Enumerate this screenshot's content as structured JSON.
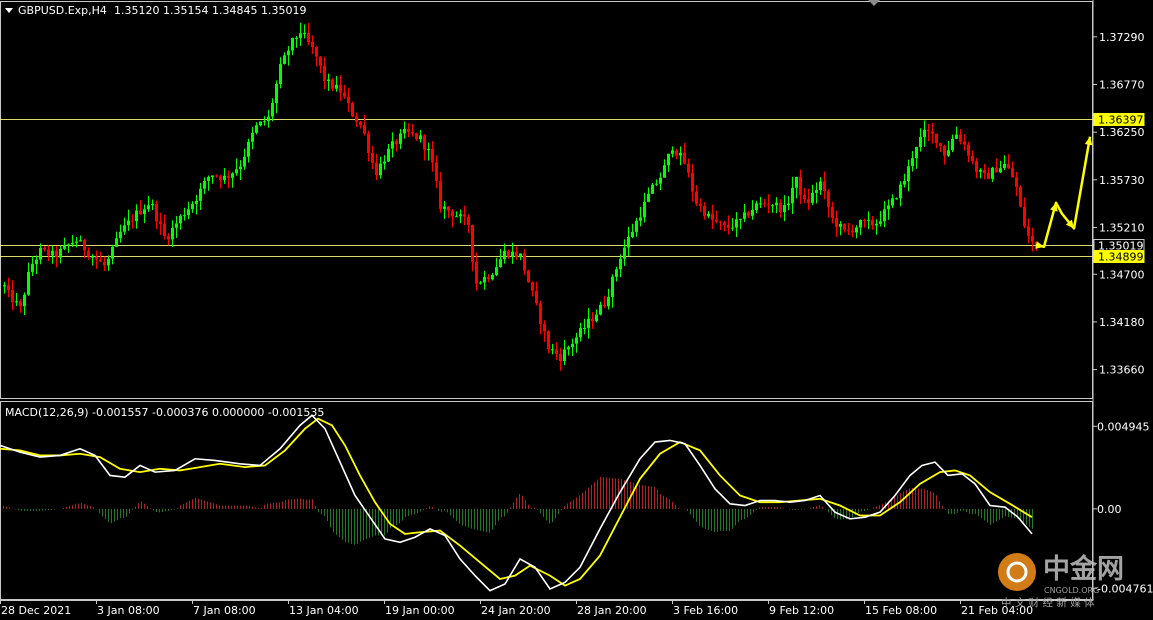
{
  "symbol_header": {
    "symbol": "GBPUSD.Exp,H4",
    "ohlc": "1.35120 1.35154 1.34845 1.35019"
  },
  "macd_header": {
    "label": "MACD(12,26,9) -0.001557 -0.000376 0.000000 -0.001535"
  },
  "colors": {
    "background": "#000000",
    "frame": "#c8c8c8",
    "bull_candle": "#00ff00",
    "bear_candle": "#ff0000",
    "level_line": "#ffff80",
    "yellow": "#ffff00",
    "macd_hist_up": "#b22222",
    "macd_hist_down": "#1f7a1f",
    "macd_line": "#ffffff",
    "signal_line": "#ffff00"
  },
  "watermark": {
    "name": "中金网",
    "sub": "CNGOLD.ORG",
    "tagline": "中 文 财 经 新 媒 体"
  },
  "chart_data": [
    {
      "type": "candlestick",
      "timeframe": "H4",
      "x_ticks": [
        "28 Dec 2021",
        "3 Jan 08:00",
        "7 Jan 08:00",
        "13 Jan 04:00",
        "19 Jan 00:00",
        "24 Jan 20:00",
        "28 Jan 20:00",
        "3 Feb 16:00",
        "9 Feb 12:00",
        "15 Feb 08:00",
        "21 Feb 04:00"
      ],
      "y_ticks": [
        1.3729,
        1.3677,
        1.3625,
        1.3573,
        1.3521,
        1.347,
        1.3418,
        1.3366
      ],
      "y_tick_labels": [
        "1.37290",
        "1.36770",
        "1.36250",
        "1.35730",
        "1.35210",
        "1.34700",
        "1.34180",
        "1.33660"
      ],
      "ylim": [
        1.3335,
        1.3767
      ],
      "levels": [
        {
          "value": 1.36397,
          "label": "1.36397",
          "tag_bg": "#ffff00",
          "tag_fg": "#000000"
        },
        {
          "value": 1.35019,
          "label": "1.35019",
          "tag_bg": "#000000",
          "tag_fg": "#ffffff"
        },
        {
          "value": 1.34899,
          "label": "1.34899",
          "tag_bg": "#ffff00",
          "tag_fg": "#000000"
        }
      ],
      "close_path": [
        [
          0,
          1.3465
        ],
        [
          8,
          1.3448
        ],
        [
          20,
          1.3432
        ],
        [
          30,
          1.3478
        ],
        [
          40,
          1.3495
        ],
        [
          55,
          1.349
        ],
        [
          75,
          1.3508
        ],
        [
          90,
          1.3492
        ],
        [
          105,
          1.3478
        ],
        [
          120,
          1.3515
        ],
        [
          135,
          1.3535
        ],
        [
          150,
          1.3549
        ],
        [
          165,
          1.3508
        ],
        [
          180,
          1.3532
        ],
        [
          195,
          1.3552
        ],
        [
          210,
          1.358
        ],
        [
          225,
          1.3575
        ],
        [
          240,
          1.359
        ],
        [
          255,
          1.363
        ],
        [
          268,
          1.364
        ],
        [
          280,
          1.3695
        ],
        [
          290,
          1.372
        ],
        [
          300,
          1.3735
        ],
        [
          315,
          1.371
        ],
        [
          325,
          1.368
        ],
        [
          340,
          1.367
        ],
        [
          352,
          1.3645
        ],
        [
          362,
          1.363
        ],
        [
          375,
          1.358
        ],
        [
          390,
          1.3608
        ],
        [
          405,
          1.3625
        ],
        [
          420,
          1.3618
        ],
        [
          430,
          1.36
        ],
        [
          440,
          1.3545
        ],
        [
          455,
          1.3535
        ],
        [
          468,
          1.3525
        ],
        [
          475,
          1.346
        ],
        [
          490,
          1.347
        ],
        [
          505,
          1.3495
        ],
        [
          520,
          1.349
        ],
        [
          530,
          1.3455
        ],
        [
          540,
          1.342
        ],
        [
          548,
          1.339
        ],
        [
          560,
          1.338
        ],
        [
          575,
          1.34
        ],
        [
          590,
          1.342
        ],
        [
          605,
          1.344
        ],
        [
          620,
          1.349
        ],
        [
          635,
          1.3525
        ],
        [
          650,
          1.356
        ],
        [
          662,
          1.358
        ],
        [
          672,
          1.361
        ],
        [
          685,
          1.359
        ],
        [
          695,
          1.355
        ],
        [
          710,
          1.353
        ],
        [
          725,
          1.352
        ],
        [
          740,
          1.3528
        ],
        [
          755,
          1.3545
        ],
        [
          770,
          1.3548
        ],
        [
          785,
          1.354
        ],
        [
          795,
          1.3575
        ],
        [
          805,
          1.3545
        ],
        [
          820,
          1.357
        ],
        [
          832,
          1.353
        ],
        [
          845,
          1.3515
        ],
        [
          860,
          1.3525
        ],
        [
          875,
          1.3525
        ],
        [
          890,
          1.3545
        ],
        [
          905,
          1.3575
        ],
        [
          915,
          1.361
        ],
        [
          925,
          1.3625
        ],
        [
          935,
          1.362
        ],
        [
          945,
          1.36
        ],
        [
          955,
          1.3625
        ],
        [
          965,
          1.361
        ],
        [
          975,
          1.3585
        ],
        [
          985,
          1.3575
        ],
        [
          995,
          1.3585
        ],
        [
          1005,
          1.359
        ],
        [
          1015,
          1.357
        ],
        [
          1022,
          1.353
        ],
        [
          1030,
          1.3505
        ],
        [
          1036,
          1.35019
        ]
      ],
      "forecast_path": [
        [
          1036,
          1.35019
        ],
        [
          1044,
          1.35
        ],
        [
          1056,
          1.3548
        ],
        [
          1062,
          1.3536
        ],
        [
          1074,
          1.352
        ],
        [
          1090,
          1.362
        ]
      ]
    },
    {
      "type": "macd",
      "params": "12,26,9",
      "y_tick_labels": [
        "0.004945",
        "0.00",
        "-0.004761"
      ],
      "y_ticks": [
        0.004945,
        0.0,
        -0.004761
      ],
      "ylim": [
        -0.0054,
        0.0064
      ],
      "macd_path": [
        [
          0,
          0.0038
        ],
        [
          20,
          0.0034
        ],
        [
          40,
          0.0031
        ],
        [
          60,
          0.0032
        ],
        [
          80,
          0.0036
        ],
        [
          95,
          0.0032
        ],
        [
          110,
          0.002
        ],
        [
          125,
          0.0019
        ],
        [
          140,
          0.0026
        ],
        [
          155,
          0.0022
        ],
        [
          175,
          0.0023
        ],
        [
          195,
          0.003
        ],
        [
          215,
          0.0029
        ],
        [
          240,
          0.0027
        ],
        [
          260,
          0.0026
        ],
        [
          280,
          0.0036
        ],
        [
          300,
          0.005
        ],
        [
          312,
          0.0056
        ],
        [
          325,
          0.0048
        ],
        [
          340,
          0.0028
        ],
        [
          355,
          0.0008
        ],
        [
          370,
          -0.0005
        ],
        [
          385,
          -0.0018
        ],
        [
          400,
          -0.002
        ],
        [
          415,
          -0.0017
        ],
        [
          430,
          -0.0012
        ],
        [
          445,
          -0.0016
        ],
        [
          460,
          -0.003
        ],
        [
          475,
          -0.004
        ],
        [
          490,
          -0.0049
        ],
        [
          505,
          -0.0045
        ],
        [
          520,
          -0.003
        ],
        [
          535,
          -0.0035
        ],
        [
          550,
          -0.0048
        ],
        [
          565,
          -0.0044
        ],
        [
          580,
          -0.0035
        ],
        [
          600,
          -0.0012
        ],
        [
          620,
          0.001
        ],
        [
          640,
          0.003
        ],
        [
          655,
          0.004
        ],
        [
          670,
          0.0041
        ],
        [
          685,
          0.0039
        ],
        [
          700,
          0.0026
        ],
        [
          715,
          0.0012
        ],
        [
          730,
          0.0003
        ],
        [
          745,
          0.0002
        ],
        [
          760,
          0.0005
        ],
        [
          775,
          0.0005
        ],
        [
          790,
          0.0004
        ],
        [
          805,
          0.0005
        ],
        [
          820,
          0.0008
        ],
        [
          835,
          -0.0002
        ],
        [
          850,
          -0.0006
        ],
        [
          865,
          -0.0005
        ],
        [
          880,
          -0.0002
        ],
        [
          895,
          0.0008
        ],
        [
          910,
          0.002
        ],
        [
          922,
          0.0026
        ],
        [
          935,
          0.0028
        ],
        [
          948,
          0.002
        ],
        [
          962,
          0.0021
        ],
        [
          975,
          0.0015
        ],
        [
          990,
          0.0002
        ],
        [
          1005,
          0.0001
        ],
        [
          1018,
          -0.0005
        ],
        [
          1032,
          -0.0015
        ]
      ],
      "signal_path": [
        [
          0,
          0.0036
        ],
        [
          20,
          0.0035
        ],
        [
          40,
          0.0032
        ],
        [
          60,
          0.0032
        ],
        [
          80,
          0.0033
        ],
        [
          100,
          0.0031
        ],
        [
          120,
          0.0024
        ],
        [
          140,
          0.0022
        ],
        [
          160,
          0.0024
        ],
        [
          180,
          0.0023
        ],
        [
          200,
          0.0025
        ],
        [
          220,
          0.0027
        ],
        [
          245,
          0.0025
        ],
        [
          265,
          0.0026
        ],
        [
          285,
          0.0035
        ],
        [
          305,
          0.0048
        ],
        [
          318,
          0.0054
        ],
        [
          332,
          0.005
        ],
        [
          345,
          0.0038
        ],
        [
          360,
          0.002
        ],
        [
          375,
          0.0004
        ],
        [
          390,
          -0.0009
        ],
        [
          405,
          -0.0015
        ],
        [
          420,
          -0.0014
        ],
        [
          440,
          -0.0013
        ],
        [
          460,
          -0.0022
        ],
        [
          480,
          -0.0032
        ],
        [
          500,
          -0.0042
        ],
        [
          515,
          -0.004
        ],
        [
          530,
          -0.0034
        ],
        [
          550,
          -0.004
        ],
        [
          565,
          -0.0046
        ],
        [
          580,
          -0.0042
        ],
        [
          600,
          -0.0028
        ],
        [
          620,
          -0.0005
        ],
        [
          640,
          0.0018
        ],
        [
          660,
          0.0033
        ],
        [
          680,
          0.004
        ],
        [
          700,
          0.0035
        ],
        [
          720,
          0.002
        ],
        [
          740,
          0.0008
        ],
        [
          760,
          0.0004
        ],
        [
          780,
          0.0004
        ],
        [
          800,
          0.0005
        ],
        [
          820,
          0.0006
        ],
        [
          840,
          0.0002
        ],
        [
          860,
          -0.0004
        ],
        [
          880,
          -0.0004
        ],
        [
          900,
          0.0004
        ],
        [
          920,
          0.0015
        ],
        [
          940,
          0.0022
        ],
        [
          955,
          0.0023
        ],
        [
          970,
          0.002
        ],
        [
          990,
          0.001
        ],
        [
          1010,
          0.0003
        ],
        [
          1032,
          -0.0005
        ]
      ]
    }
  ]
}
